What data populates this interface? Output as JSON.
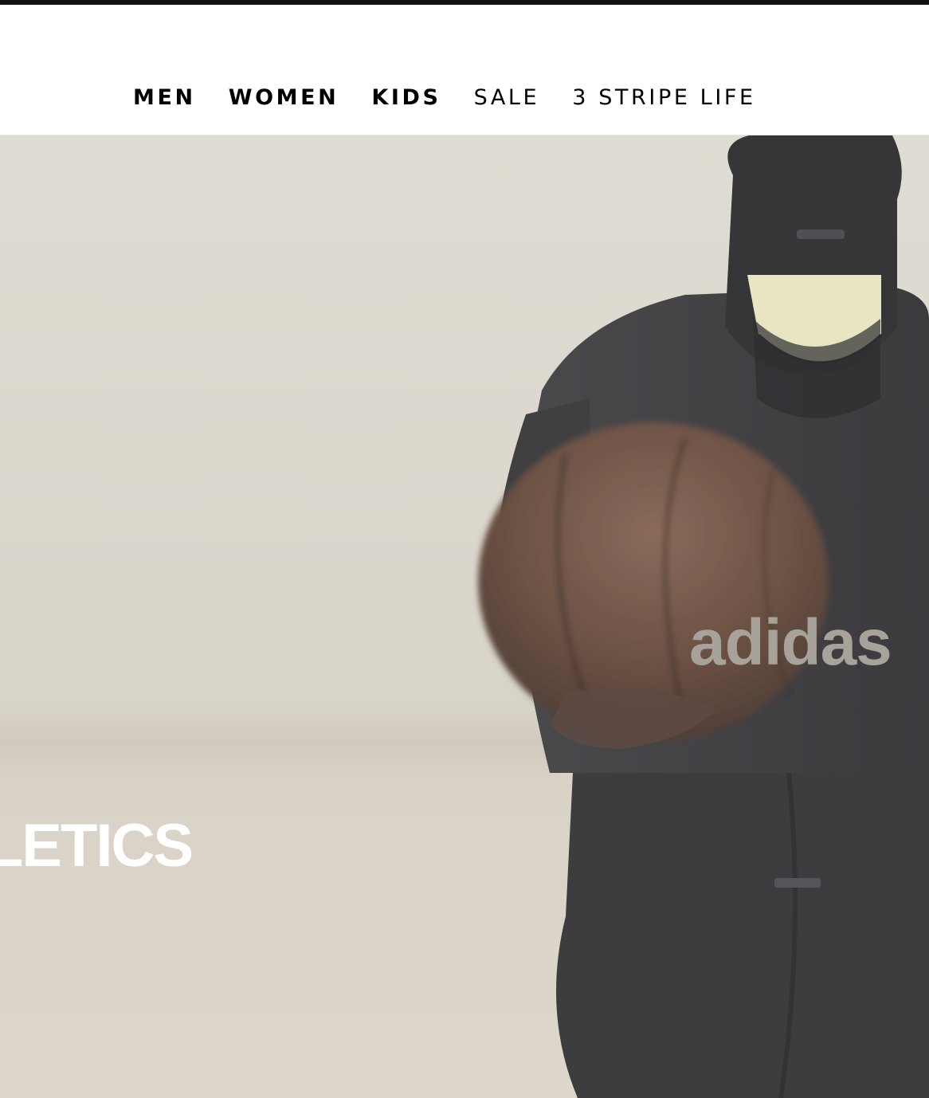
{
  "nav": {
    "items": [
      {
        "label": "MEN",
        "weight": "bold"
      },
      {
        "label": "WOMEN",
        "weight": "bold"
      },
      {
        "label": "KIDS",
        "weight": "bold"
      },
      {
        "label": "SALE",
        "weight": "light"
      },
      {
        "label": "3 STRIPE LIFE",
        "weight": "light"
      }
    ]
  },
  "hero": {
    "headline": "HLETICS",
    "shirt_logo": "adidas",
    "colors": {
      "background": "#dcd8ce",
      "garment": "#3f3e41",
      "ball": "#6f5447",
      "visor": "#e8e5c2"
    }
  }
}
